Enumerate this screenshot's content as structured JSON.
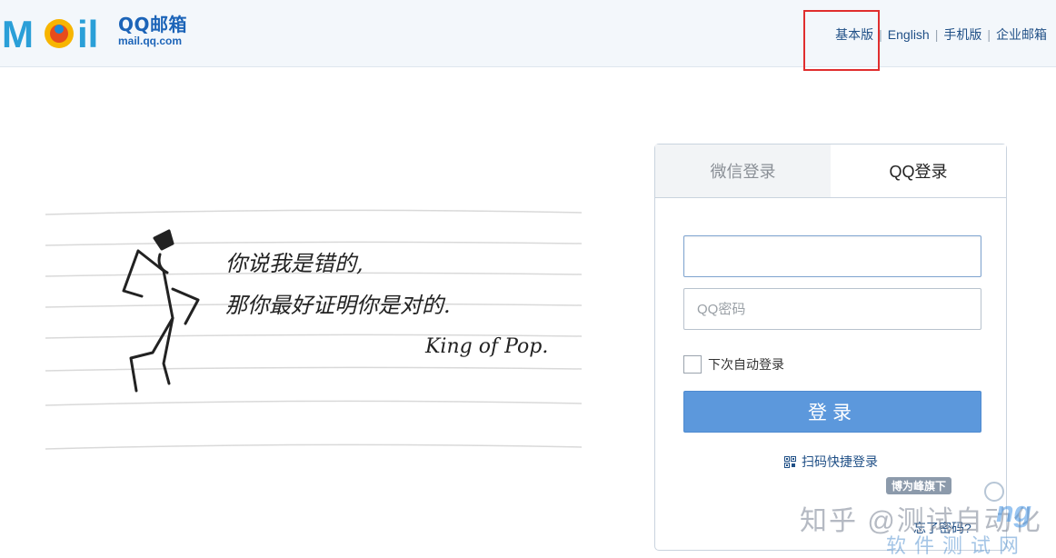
{
  "header": {
    "logo_word": "MOil",
    "logo_title": "QQ邮箱",
    "logo_domain": "mail.qq.com",
    "links": [
      {
        "label": "基本版"
      },
      {
        "label": "English"
      },
      {
        "label": "手机版"
      },
      {
        "label": "企业邮箱"
      }
    ],
    "separator": "|"
  },
  "hero": {
    "line1": "你说我是错的,",
    "line2": "那你最好证明你是对的.",
    "signature": "King of Pop."
  },
  "login": {
    "tabs": [
      {
        "label": "微信登录",
        "active": false
      },
      {
        "label": "QQ登录",
        "active": true
      }
    ],
    "account_value": "",
    "password_placeholder": "QQ密码",
    "remember_label": "下次自动登录",
    "remember_checked": false,
    "submit_label": "登录",
    "qr_login_label": "扫码快捷登录",
    "forgot_label": "忘了密码?"
  },
  "watermark": {
    "badge": "博为峰旗下",
    "zhihu": "知乎 @测试自动化",
    "brand": "ng",
    "sub": "软件测试网"
  },
  "colors": {
    "header_bg": "#f3f7fb",
    "link": "#1f4f86",
    "button": "#5c98dc",
    "highlight": "#e02e2e"
  }
}
